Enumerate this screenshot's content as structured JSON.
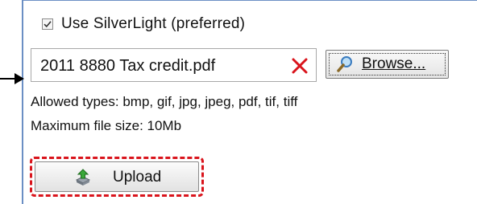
{
  "silverlight_option": {
    "label": "Use SilverLight (preferred)",
    "checked": true
  },
  "file_picker": {
    "file_name": "2011 8880 Tax credit.pdf",
    "remove_icon": "red-x-icon",
    "browse_label": "Browse...",
    "browse_icon": "magnifier-icon"
  },
  "info": {
    "allowed_types": "Allowed types: bmp, gif, jpg, jpeg, pdf, tif, tiff",
    "max_size": "Maximum file size: 10Mb"
  },
  "upload": {
    "label": "Upload",
    "icon": "upload-arrow-icon",
    "highlight_color": "#d9141c"
  },
  "colors": {
    "accent_line": "#6b8fc4",
    "remove_red": "#d9141c"
  }
}
